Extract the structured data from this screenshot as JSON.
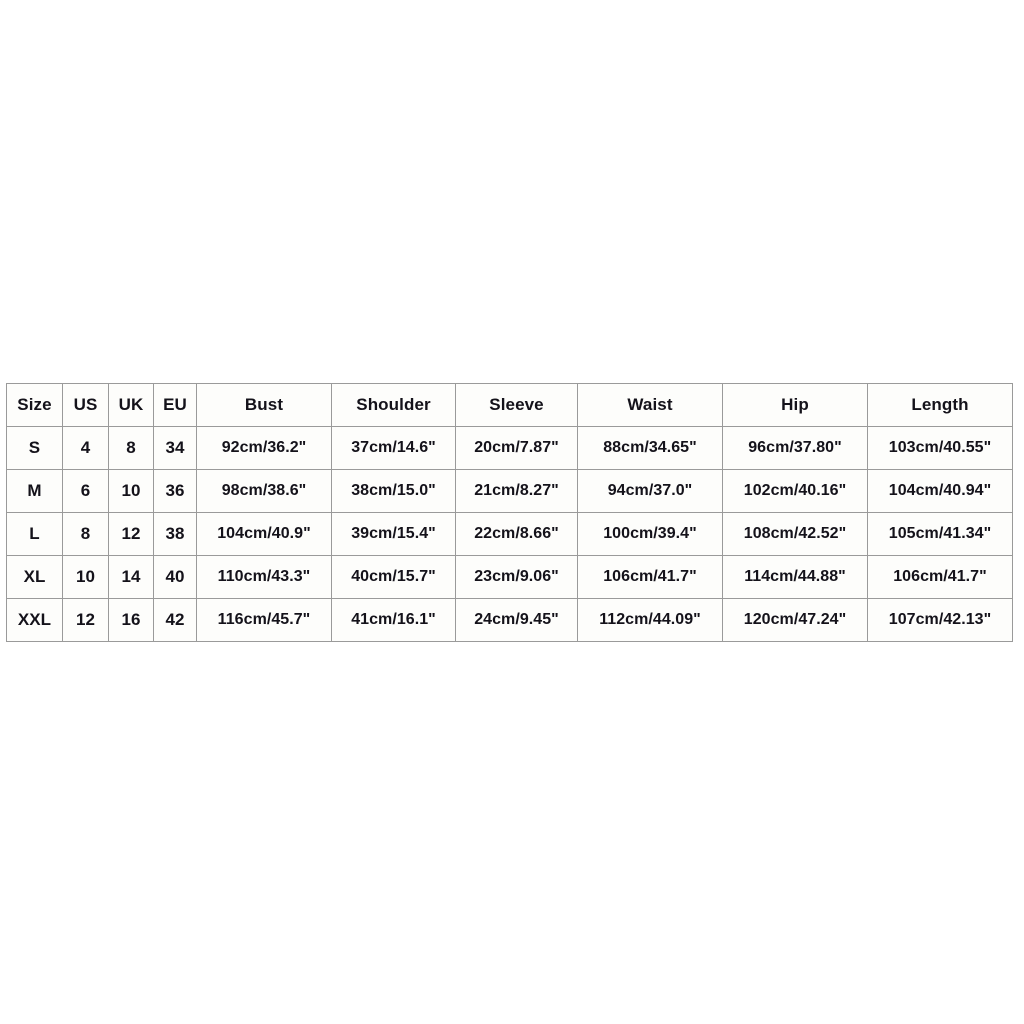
{
  "table": {
    "kind": "size-chart",
    "columns": [
      "Size",
      "US",
      "UK",
      "EU",
      "Bust",
      "Shoulder",
      "Sleeve",
      "Waist",
      "Hip",
      "Length"
    ],
    "rows": [
      {
        "size": "S",
        "us": "4",
        "uk": "8",
        "eu": "34",
        "bust": "92cm/36.2\"",
        "shoulder": "37cm/14.6\"",
        "sleeve": "20cm/7.87\"",
        "waist": "88cm/34.65\"",
        "hip": "96cm/37.80\"",
        "length": "103cm/40.55\""
      },
      {
        "size": "M",
        "us": "6",
        "uk": "10",
        "eu": "36",
        "bust": "98cm/38.6\"",
        "shoulder": "38cm/15.0\"",
        "sleeve": "21cm/8.27\"",
        "waist": "94cm/37.0\"",
        "hip": "102cm/40.16\"",
        "length": "104cm/40.94\""
      },
      {
        "size": "L",
        "us": "8",
        "uk": "12",
        "eu": "38",
        "bust": "104cm/40.9\"",
        "shoulder": "39cm/15.4\"",
        "sleeve": "22cm/8.66\"",
        "waist": "100cm/39.4\"",
        "hip": "108cm/42.52\"",
        "length": "105cm/41.34\""
      },
      {
        "size": "XL",
        "us": "10",
        "uk": "14",
        "eu": "40",
        "bust": "110cm/43.3\"",
        "shoulder": "40cm/15.7\"",
        "sleeve": "23cm/9.06\"",
        "waist": "106cm/41.7\"",
        "hip": "114cm/44.88\"",
        "length": "106cm/41.7\""
      },
      {
        "size": "XXL",
        "us": "12",
        "uk": "16",
        "eu": "42",
        "bust": "116cm/45.7\"",
        "shoulder": "41cm/16.1\"",
        "sleeve": "24cm/9.45\"",
        "waist": "112cm/44.09\"",
        "hip": "120cm/47.24\"",
        "length": "107cm/42.13\""
      }
    ]
  },
  "colors": {
    "page_background": "#ffffff",
    "cell_background": "#fdfdfb",
    "border": "#9a9a9a",
    "text": "#14121a"
  }
}
